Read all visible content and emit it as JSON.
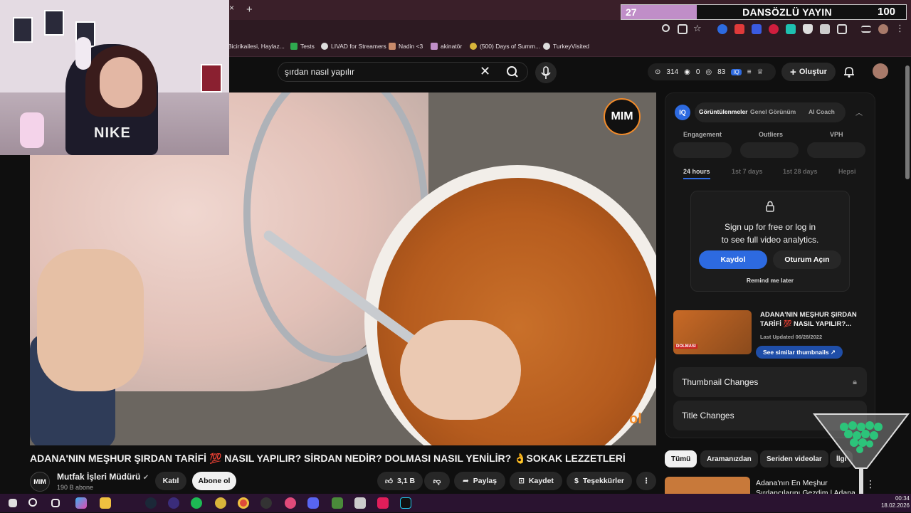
{
  "browser": {
    "tab_close": "×",
    "new_tab": "+",
    "bookmarks": [
      {
        "label": "Bicirikailesi, Haylaz..."
      },
      {
        "label": "Tests"
      },
      {
        "label": "LIVAD for Streamers"
      },
      {
        "label": "Nadin <3"
      },
      {
        "label": "akinatör"
      },
      {
        "label": "(500) Days of Summ..."
      },
      {
        "label": "TurkeyVisited"
      }
    ]
  },
  "overlay": {
    "counter_left": "27",
    "title": "DANSÖZLÜ YAYIN",
    "counter_right": "100"
  },
  "youtube": {
    "search_value": "şırdan nasıl yapılır",
    "stats": {
      "views": "314",
      "eye": "0",
      "coins": "83"
    },
    "create_label": "Oluştur"
  },
  "video": {
    "title": "ADANA'NIN MEŞHUR ŞIRDAN TARİFİ 💯 NASIL YAPILIR? SİRDAN NEDİR? DOLMASI NASIL YENİLİR? 👌SOKAK LEZZETLERİ",
    "logo_text": "MIM",
    "subscribe_overlay": "ol",
    "channel": {
      "avatar_text": "MIM",
      "name": "Mutfak İşleri Müdürü",
      "subs": "190 B abone",
      "join_label": "Katıl",
      "subscribe_label": "Abone ol"
    },
    "actions": {
      "likes": "3,1 B",
      "share": "Paylaş",
      "save": "Kaydet",
      "thanks": "Teşekkürler",
      "more": "⋮"
    }
  },
  "panel": {
    "logo": "IQ",
    "tabs": [
      "Görüntülenmeler",
      "Genel Görünüm",
      "AI Coach"
    ],
    "metrics": [
      "Engagement",
      "Outliers",
      "VPH"
    ],
    "ranges": [
      "24 hours",
      "1st 7 days",
      "1st 28 days",
      "Hepsi"
    ],
    "lock_line1": "Sign up for free or log in",
    "lock_line2": "to see full video analytics.",
    "signup_label": "Kaydol",
    "login_label": "Oturum Açın",
    "remind_label": "Remind me later",
    "related_title": "ADANA'NIN MEŞHUR ŞIRDAN TARİFİ 💯 NASIL YAPILIR?...",
    "related_date": "Last Updated 06/28/2022",
    "similar_label": "See similar thumbnails ↗",
    "thumb_text": "DOLMASI",
    "sections": [
      "Thumbnail Changes",
      "Title Changes"
    ]
  },
  "chips": [
    "Tümü",
    "Aramanızdan",
    "Seriden videolar",
    "İlgi"
  ],
  "recommendation": {
    "title": "Adana'nın En Meşhur Şırdancılarını Gezdim | Adana"
  },
  "taskbar": {
    "time": "00:34",
    "date": "18.02.2026"
  }
}
